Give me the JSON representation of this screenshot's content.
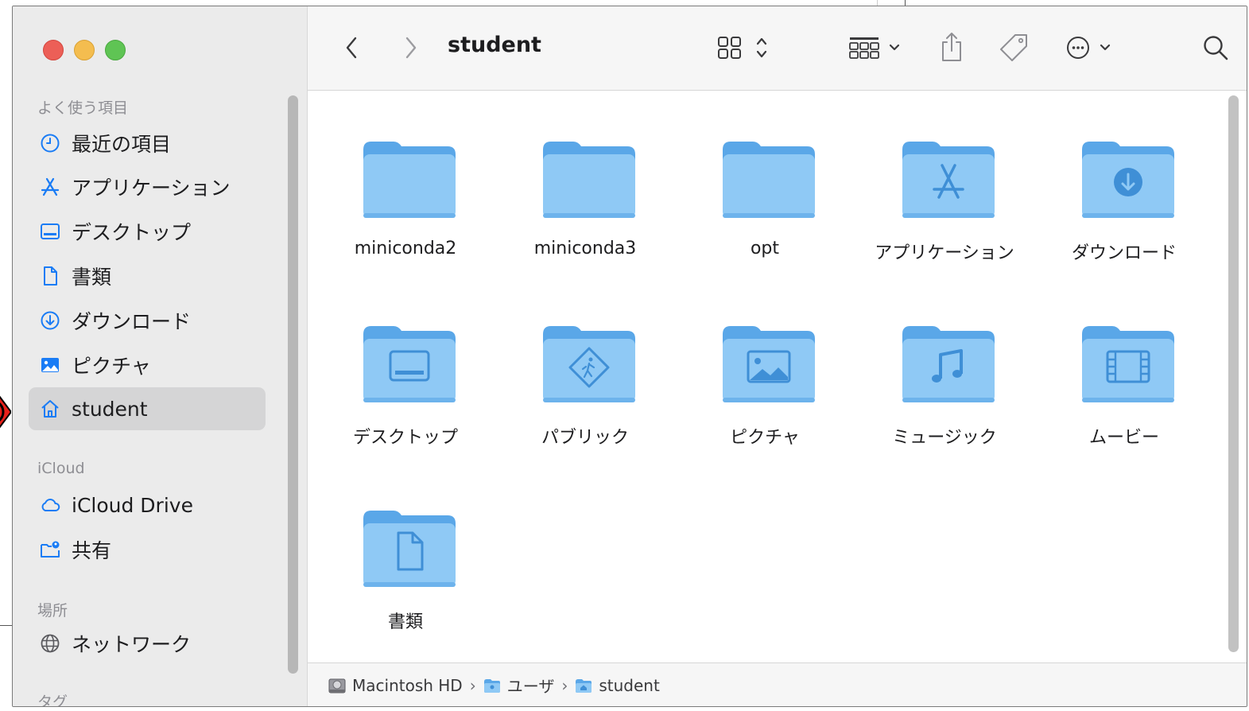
{
  "window": {
    "title": "student"
  },
  "sidebar": {
    "sections": [
      {
        "heading": "よく使う項目",
        "items": [
          {
            "label": "最近の項目",
            "icon": "clock-icon"
          },
          {
            "label": "アプリケーション",
            "icon": "applications-icon"
          },
          {
            "label": "デスクトップ",
            "icon": "desktop-icon"
          },
          {
            "label": "書類",
            "icon": "document-icon"
          },
          {
            "label": "ダウンロード",
            "icon": "download-icon"
          },
          {
            "label": "ピクチャ",
            "icon": "photo-icon"
          },
          {
            "label": "student",
            "icon": "home-icon",
            "selected": true
          }
        ]
      },
      {
        "heading": "iCloud",
        "items": [
          {
            "label": "iCloud Drive",
            "icon": "cloud-icon"
          },
          {
            "label": "共有",
            "icon": "shared-folder-icon"
          }
        ]
      },
      {
        "heading": "場所",
        "items": [
          {
            "label": "ネットワーク",
            "icon": "network-globe-icon"
          }
        ]
      },
      {
        "heading": "タグ",
        "items": []
      }
    ]
  },
  "toolbar": {
    "title": "student",
    "icons": [
      "back-icon",
      "forward-icon",
      "icon-view-icon",
      "group-icon",
      "share-icon",
      "tag-icon",
      "more-actions-icon",
      "search-icon"
    ]
  },
  "files": [
    {
      "name": "miniconda2",
      "glyph": "none"
    },
    {
      "name": "miniconda3",
      "glyph": "none"
    },
    {
      "name": "opt",
      "glyph": "none"
    },
    {
      "name": "アプリケーション",
      "glyph": "applications"
    },
    {
      "name": "ダウンロード",
      "glyph": "download"
    },
    {
      "name": "デスクトップ",
      "glyph": "desktop"
    },
    {
      "name": "パブリック",
      "glyph": "public"
    },
    {
      "name": "ピクチャ",
      "glyph": "pictures"
    },
    {
      "name": "ミュージック",
      "glyph": "music"
    },
    {
      "name": "ムービー",
      "glyph": "movies"
    },
    {
      "name": "書類",
      "glyph": "documents"
    }
  ],
  "pathbar": {
    "segments": [
      "Macintosh HD",
      "ユーザ",
      "student"
    ],
    "separator": "›"
  },
  "colors": {
    "accent": "#1a7cf5",
    "folder_body": "#8fc9f5",
    "folder_tab": "#5aa7e8",
    "folder_glyph": "#3f8fd6"
  }
}
